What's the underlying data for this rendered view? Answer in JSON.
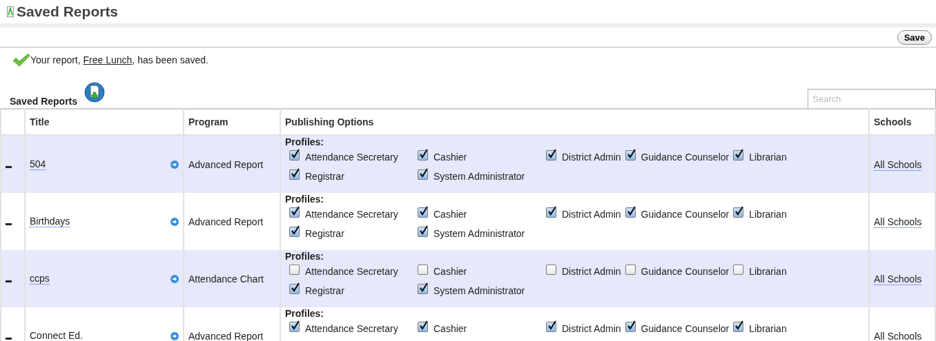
{
  "page_title": "Saved Reports",
  "save_button": "Save",
  "message": {
    "before": "Your report, ",
    "link": "Free Lunch",
    "after": ", has been saved."
  },
  "section_title": "Saved Reports",
  "search": {
    "placeholder": "Search"
  },
  "columns": [
    "Title",
    "Program",
    "Publishing Options",
    "Schools"
  ],
  "rows": [
    {
      "title": "504",
      "program": "Advanced Report",
      "profiles_label": "Profiles:",
      "profiles": [
        {
          "label": "Attendance Secretary",
          "checked": true
        },
        {
          "label": "Cashier",
          "checked": true
        },
        {
          "label": "District Admin",
          "checked": true
        },
        {
          "label": "Guidance Counselor",
          "checked": true
        },
        {
          "label": "Librarian",
          "checked": true
        },
        {
          "label": "Registrar",
          "checked": true
        },
        {
          "label": "System Administrator",
          "checked": true
        }
      ],
      "schools": "All Schools"
    },
    {
      "title": "Birthdays",
      "program": "Advanced Report",
      "profiles_label": "Profiles:",
      "profiles": [
        {
          "label": "Attendance Secretary",
          "checked": true
        },
        {
          "label": "Cashier",
          "checked": true
        },
        {
          "label": "District Admin",
          "checked": true
        },
        {
          "label": "Guidance Counselor",
          "checked": true
        },
        {
          "label": "Librarian",
          "checked": true
        },
        {
          "label": "Registrar",
          "checked": true
        },
        {
          "label": "System Administrator",
          "checked": true
        }
      ],
      "schools": "All Schools"
    },
    {
      "title": "ccps",
      "program": "Attendance Chart",
      "profiles_label": "Profiles:",
      "profiles": [
        {
          "label": "Attendance Secretary",
          "checked": false
        },
        {
          "label": "Cashier",
          "checked": false
        },
        {
          "label": "District Admin",
          "checked": false
        },
        {
          "label": "Guidance Counselor",
          "checked": false
        },
        {
          "label": "Librarian",
          "checked": false
        },
        {
          "label": "Registrar",
          "checked": true
        },
        {
          "label": "System Administrator",
          "checked": true
        }
      ],
      "schools": "All Schools"
    },
    {
      "title": "Connect Ed.",
      "program": "Advanced Report",
      "profiles_label": "Profiles:",
      "profiles": [
        {
          "label": "Attendance Secretary",
          "checked": true
        },
        {
          "label": "Cashier",
          "checked": true
        },
        {
          "label": "District Admin",
          "checked": true
        },
        {
          "label": "Guidance Counselor",
          "checked": true
        },
        {
          "label": "Librarian",
          "checked": true
        }
      ],
      "schools": "All Schools"
    }
  ]
}
